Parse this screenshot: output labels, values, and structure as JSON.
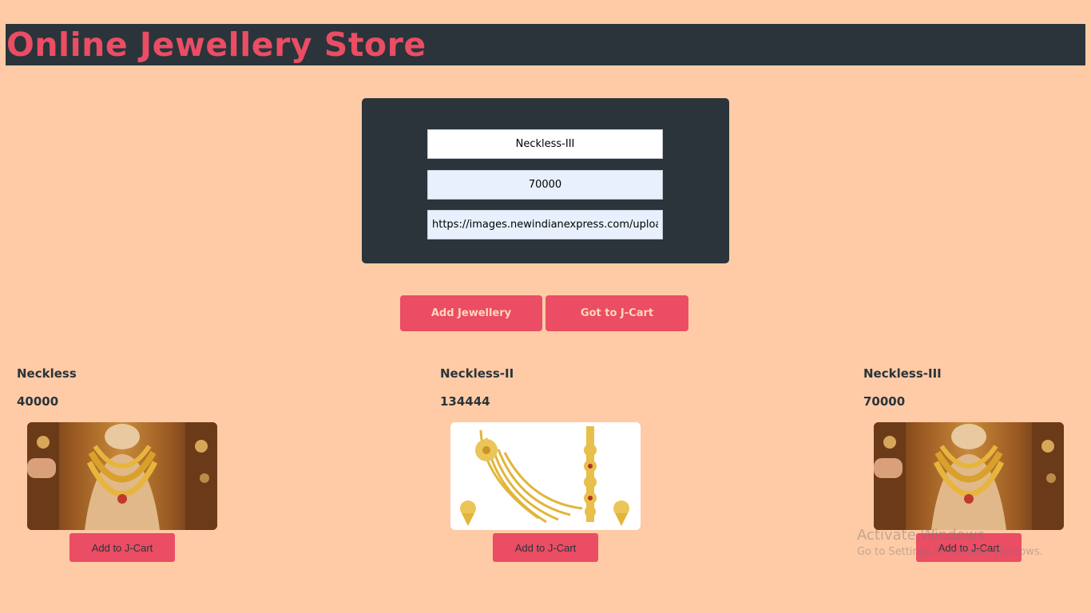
{
  "header": {
    "title": "Online Jewellery Store"
  },
  "form": {
    "name_value": "Neckless-III",
    "price_value": "70000",
    "url_value": "https://images.newindianexpress.com/uploads/u"
  },
  "actions": {
    "add_label": "Add Jewellery",
    "cart_label": "Got to J-Cart"
  },
  "products": [
    {
      "name": "Neckless",
      "price": "40000",
      "button": "Add to J-Cart",
      "image": "gold-necklace-showroom"
    },
    {
      "name": "Neckless-II",
      "price": "134444",
      "button": "Add to J-Cart",
      "image": "gold-layered-necklace-white"
    },
    {
      "name": "Neckless-III",
      "price": "70000",
      "button": "Add to J-Cart",
      "image": "gold-necklace-showroom"
    }
  ],
  "watermark": {
    "line1": "Activate Windows",
    "line2": "Go to Settings to activate Windows."
  },
  "colors": {
    "background": "#ffcba6",
    "header_bg": "#2a343a",
    "accent": "#ea4d64"
  }
}
